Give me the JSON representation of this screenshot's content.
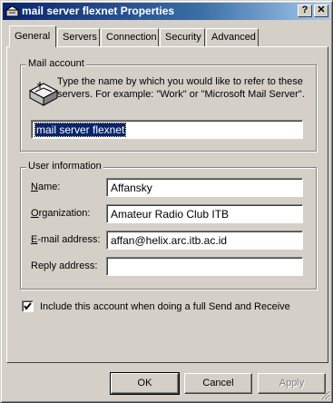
{
  "window": {
    "title": "mail server flexnet Properties",
    "help_glyph": "?",
    "close_glyph": "✕"
  },
  "tabs": [
    {
      "label": "General",
      "active": true
    },
    {
      "label": "Servers",
      "active": false
    },
    {
      "label": "Connection",
      "active": false
    },
    {
      "label": "Security",
      "active": false
    },
    {
      "label": "Advanced",
      "active": false
    }
  ],
  "mail_account": {
    "legend": "Mail account",
    "icon": "mail-server-icon",
    "description": "Type the name by which you would like to refer to these servers.  For example: \"Work\" or \"Microsoft Mail Server\".",
    "account_name": "mail server flexnet"
  },
  "user_information": {
    "legend": "User information",
    "name_label": "Name:",
    "name_value": "Affansky",
    "organization_label": "Organization:",
    "organization_value": "Amateur Radio Club ITB",
    "email_label": "E-mail address:",
    "email_value": "affan@helix.arc.itb.ac.id",
    "reply_label": "Reply address:",
    "reply_value": ""
  },
  "include_checkbox": {
    "label": "Include this account when doing a full Send and Receive",
    "checked": true
  },
  "buttons": {
    "ok": "OK",
    "cancel": "Cancel",
    "apply": "Apply"
  },
  "colors": {
    "titlebar_start": "#0a246a",
    "titlebar_end": "#a6caf0",
    "face": "#d4d0c8",
    "selection": "#0a246a"
  }
}
